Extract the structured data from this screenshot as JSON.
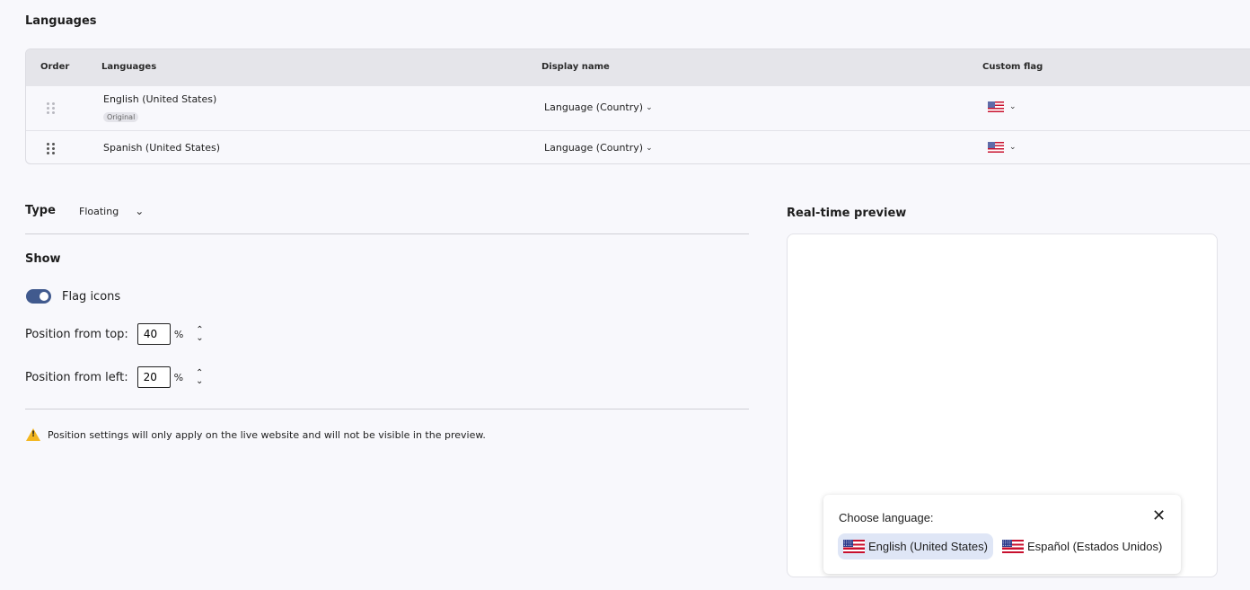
{
  "languages_section": {
    "title": "Languages",
    "columns": [
      "Order",
      "Languages",
      "Display name",
      "Custom flag"
    ],
    "rows": [
      {
        "name": "English (United States)",
        "badge": "Original",
        "display_name": "Language (Country)",
        "flag_icon": "us-flag-icon"
      },
      {
        "name": "Spanish (United States)",
        "badge": "",
        "display_name": "Language (Country)",
        "flag_icon": "us-flag-icon"
      }
    ]
  },
  "settings": {
    "type_label": "Type",
    "type_value": "Floating",
    "show_label": "Show",
    "flag_icons_label": "Flag icons",
    "flag_icons_enabled": true,
    "position_top_label": "Position from top:",
    "position_top_value": "40",
    "position_left_label": "Position from left:",
    "position_left_value": "20",
    "percent": "%",
    "warning": "Position settings will only apply on the live website and will not be visible in the preview."
  },
  "preview": {
    "title": "Real-time preview",
    "choose_label": "Choose language:",
    "options": [
      "English (United States)",
      "Español (Estados Unidos)"
    ],
    "active_option": "English (United States)"
  },
  "colors": {
    "accent": "#415a8e",
    "warning": "#f3b61f",
    "active_pill": "#dfe6f6"
  }
}
